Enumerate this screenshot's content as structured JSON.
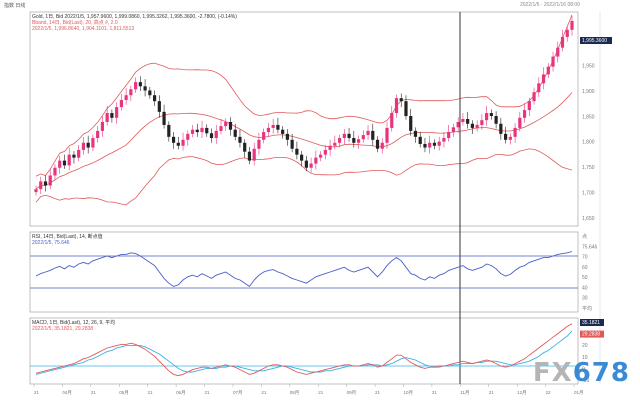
{
  "window": {
    "left_title": "指数 日线",
    "right_time": "2022/1/5 · 2022/1/16 08:00"
  },
  "panels": {
    "price": {
      "line1": "Gold, 1日, Bid   2022/1/5, 1,957.9600, 1,999.0860, 1,995.3262, 1,995.3600, -2.7800, (-0.14%)",
      "line2": "Bband, 14日, Bid(Last), 20, 高点 #, 2.0",
      "line3": "2022/1/5, 1,996.8640, 1,904.1101, 1,811.5513"
    },
    "rsi": {
      "line1": "RSI, 14日, Bid(Last), 14, 断点值",
      "line2": "2022/1/5, 75.646"
    },
    "macd": {
      "line1": "MACD, 1日, Bid(Last), 12, 26, 9, 平均",
      "line2": "2022/1/5, 35.1821, 29.2838"
    }
  },
  "price_axis_labels": [
    "1,995.3600",
    "1,950",
    "1,900",
    "1,850",
    "1,800",
    "1,750",
    "1,700",
    "1,650"
  ],
  "rsi_axis_labels": [
    "点",
    "75.646",
    "70",
    "60",
    "50",
    "40",
    "30",
    "平均"
  ],
  "macd_axis_labels": [
    "35.1821",
    "29.2838",
    "20",
    "10",
    "0",
    "-10"
  ],
  "date_axis_labels": [
    "21",
    "04月",
    "21",
    "05月",
    "21",
    "06月",
    "21",
    "07月",
    "21",
    "08月",
    "21",
    "09月",
    "21",
    "10月",
    "21",
    "11月",
    "21",
    "12月",
    "22",
    "01月"
  ],
  "watermark": {
    "fx": "FX",
    "num": "678"
  },
  "colors": {
    "up": "#e8347f",
    "down": "#222222",
    "band": "#e05a5a",
    "rsi": "#4a5ec8",
    "macd": "#e05a5a",
    "signal": "#3ab0e6",
    "cursor": "#333333"
  },
  "chart_data": [
    {
      "type": "candlestick",
      "title": "Gold, 1日, Bid",
      "ylim": [
        1650,
        2010
      ],
      "bands": "Bollinger (20, 2.0)",
      "close": [
        1712,
        1725,
        1718,
        1735,
        1748,
        1760,
        1752,
        1770,
        1765,
        1778,
        1790,
        1782,
        1798,
        1810,
        1825,
        1840,
        1832,
        1850,
        1862,
        1870,
        1880,
        1892,
        1885,
        1878,
        1870,
        1860,
        1842,
        1820,
        1800,
        1790,
        1785,
        1795,
        1805,
        1812,
        1808,
        1815,
        1806,
        1798,
        1810,
        1818,
        1825,
        1812,
        1800,
        1790,
        1775,
        1760,
        1780,
        1795,
        1808,
        1815,
        1820,
        1812,
        1805,
        1795,
        1780,
        1770,
        1760,
        1748,
        1755,
        1765,
        1770,
        1778,
        1785,
        1790,
        1798,
        1805,
        1798,
        1790,
        1796,
        1803,
        1810,
        1795,
        1780,
        1790,
        1815,
        1840,
        1865,
        1860,
        1835,
        1810,
        1800,
        1788,
        1782,
        1790,
        1785,
        1792,
        1798,
        1808,
        1816,
        1825,
        1830,
        1822,
        1815,
        1820,
        1828,
        1840,
        1835,
        1822,
        1805,
        1795,
        1800,
        1815,
        1832,
        1845,
        1860,
        1875,
        1890,
        1905,
        1918,
        1935,
        1950,
        1968,
        1980,
        1995
      ]
    },
    {
      "type": "line",
      "title": "RSI, 14日",
      "ylim": [
        0,
        100
      ],
      "levels": [
        70,
        30
      ],
      "values": [
        45,
        48,
        50,
        52,
        55,
        57,
        54,
        58,
        56,
        60,
        62,
        60,
        64,
        66,
        68,
        70,
        68,
        70,
        72,
        72,
        74,
        73,
        70,
        66,
        62,
        58,
        50,
        42,
        36,
        32,
        34,
        40,
        44,
        46,
        44,
        48,
        45,
        42,
        46,
        48,
        50,
        46,
        42,
        40,
        36,
        32,
        40,
        46,
        50,
        52,
        53,
        50,
        48,
        45,
        42,
        40,
        38,
        36,
        40,
        44,
        46,
        48,
        50,
        52,
        54,
        56,
        52,
        50,
        52,
        54,
        56,
        50,
        44,
        50,
        58,
        64,
        68,
        64,
        56,
        48,
        46,
        42,
        40,
        44,
        42,
        46,
        48,
        52,
        54,
        56,
        58,
        54,
        52,
        54,
        56,
        60,
        58,
        54,
        48,
        45,
        47,
        52,
        56,
        58,
        62,
        64,
        66,
        68,
        68,
        70,
        72,
        73,
        74,
        75.646
      ]
    },
    {
      "type": "line",
      "title": "MACD, 1日",
      "ylim": [
        -15,
        40
      ],
      "series": [
        {
          "name": "MACD",
          "values": [
            -6,
            -5,
            -4,
            -3,
            -2,
            -1,
            0,
            1,
            2,
            4,
            6,
            7,
            9,
            11,
            13,
            15,
            16,
            17,
            18,
            18,
            19,
            18,
            16,
            14,
            11,
            8,
            4,
            0,
            -4,
            -7,
            -8,
            -7,
            -5,
            -3,
            -2,
            -1,
            -1,
            -2,
            -1,
            0,
            1,
            0,
            -1,
            -3,
            -5,
            -7,
            -6,
            -4,
            -2,
            0,
            1,
            1,
            0,
            -1,
            -3,
            -5,
            -6,
            -7,
            -6,
            -5,
            -4,
            -3,
            -2,
            -1,
            0,
            1,
            1,
            0,
            0,
            1,
            2,
            1,
            -1,
            0,
            3,
            6,
            9,
            9,
            6,
            3,
            1,
            -1,
            -2,
            -1,
            -1,
            0,
            0,
            1,
            2,
            3,
            4,
            3,
            2,
            3,
            4,
            5,
            4,
            2,
            0,
            -1,
            0,
            2,
            4,
            6,
            9,
            12,
            15,
            18,
            21,
            24,
            27,
            30,
            33,
            35.1821
          ]
        },
        {
          "name": "Signal",
          "values": [
            -7,
            -6,
            -5,
            -4,
            -3,
            -2,
            -1,
            0,
            1,
            2,
            3,
            5,
            6,
            8,
            10,
            12,
            13,
            15,
            16,
            17,
            17,
            17,
            17,
            16,
            14,
            12,
            10,
            7,
            4,
            1,
            -2,
            -4,
            -5,
            -5,
            -4,
            -3,
            -2,
            -2,
            -2,
            -1,
            -1,
            0,
            0,
            -1,
            -2,
            -3,
            -4,
            -4,
            -4,
            -3,
            -2,
            -1,
            0,
            0,
            -1,
            -2,
            -3,
            -4,
            -5,
            -5,
            -5,
            -4,
            -4,
            -3,
            -2,
            -1,
            0,
            0,
            0,
            0,
            1,
            1,
            1,
            0,
            1,
            2,
            4,
            6,
            7,
            6,
            5,
            3,
            1,
            0,
            -1,
            -1,
            0,
            0,
            1,
            1,
            2,
            2,
            2,
            3,
            3,
            4,
            4,
            4,
            3,
            2,
            1,
            1,
            2,
            3,
            4,
            6,
            8,
            11,
            13,
            16,
            19,
            22,
            25,
            29.2838
          ]
        }
      ]
    }
  ]
}
